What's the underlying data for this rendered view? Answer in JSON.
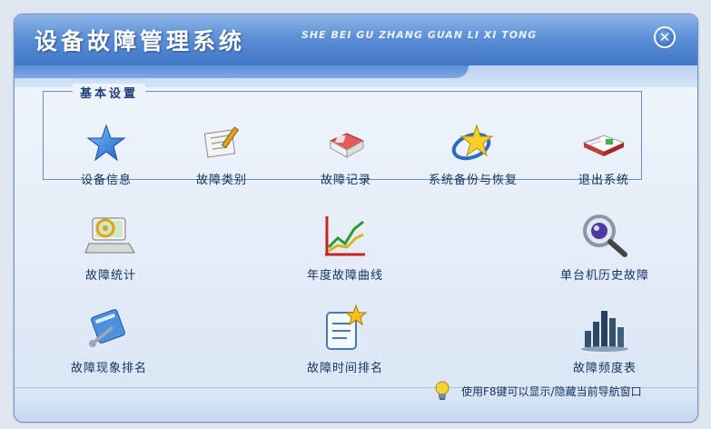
{
  "app": {
    "title_cn": "设备故障管理系统",
    "title_en": "SHE BEI GU ZHANG GUAN LI XI TONG",
    "close_glyph": "✕"
  },
  "group": {
    "title": "基本设置",
    "items": [
      {
        "label": "设备信息",
        "icon": "star-icon"
      },
      {
        "label": "故障类别",
        "icon": "note-pen-icon"
      },
      {
        "label": "故障记录",
        "icon": "book-icon"
      },
      {
        "label": "系统备份与恢复",
        "icon": "star-orbit-icon"
      },
      {
        "label": "退出系统",
        "icon": "open-book-icon"
      }
    ]
  },
  "functions": [
    {
      "label": "故障统计",
      "icon": "laptop-email-icon"
    },
    {
      "label": "年度故障曲线",
      "icon": "line-chart-icon"
    },
    {
      "label": "单台机历史故障",
      "icon": "magnifier-icon"
    },
    {
      "label": "故障现象排名",
      "icon": "tools-icon"
    },
    {
      "label": "故障时间排名",
      "icon": "document-star-icon"
    },
    {
      "label": "故障频度表",
      "icon": "bar-chart-icon"
    }
  ],
  "footer": {
    "tip": "使用F8键可以显示/隐藏当前导航窗口",
    "icon": "lightbulb-icon"
  }
}
